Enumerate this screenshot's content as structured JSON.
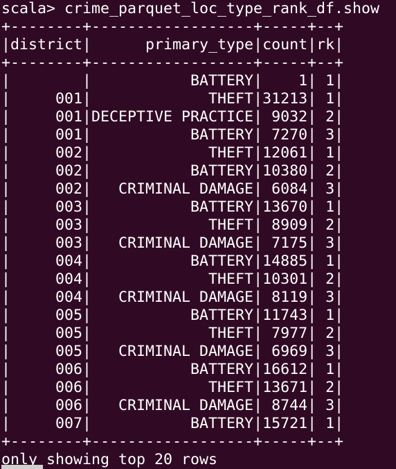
{
  "prompt": "scala>",
  "command": "crime_parquet_loc_type_rank_df.show",
  "table": {
    "columns": [
      "district",
      "primary_type",
      "count",
      "rk"
    ],
    "rows": [
      [
        "",
        "BATTERY",
        "1",
        "1"
      ],
      [
        "001",
        "THEFT",
        "31213",
        "1"
      ],
      [
        "001",
        "DECEPTIVE PRACTICE",
        "9032",
        "2"
      ],
      [
        "001",
        "BATTERY",
        "7270",
        "3"
      ],
      [
        "002",
        "THEFT",
        "12061",
        "1"
      ],
      [
        "002",
        "BATTERY",
        "10380",
        "2"
      ],
      [
        "002",
        "CRIMINAL DAMAGE",
        "6084",
        "3"
      ],
      [
        "003",
        "BATTERY",
        "13670",
        "1"
      ],
      [
        "003",
        "THEFT",
        "8909",
        "2"
      ],
      [
        "003",
        "CRIMINAL DAMAGE",
        "7175",
        "3"
      ],
      [
        "004",
        "BATTERY",
        "14885",
        "1"
      ],
      [
        "004",
        "THEFT",
        "10301",
        "2"
      ],
      [
        "004",
        "CRIMINAL DAMAGE",
        "8119",
        "3"
      ],
      [
        "005",
        "BATTERY",
        "11743",
        "1"
      ],
      [
        "005",
        "THEFT",
        "7977",
        "2"
      ],
      [
        "005",
        "CRIMINAL DAMAGE",
        "6969",
        "3"
      ],
      [
        "006",
        "BATTERY",
        "16612",
        "1"
      ],
      [
        "006",
        "THEFT",
        "13671",
        "2"
      ],
      [
        "006",
        "CRIMINAL DAMAGE",
        "8744",
        "3"
      ],
      [
        "007",
        "BATTERY",
        "15721",
        "1"
      ]
    ]
  },
  "footer": "only showing top 20 rows",
  "colors": {
    "background": "#300a24",
    "text": "#ffffff"
  }
}
